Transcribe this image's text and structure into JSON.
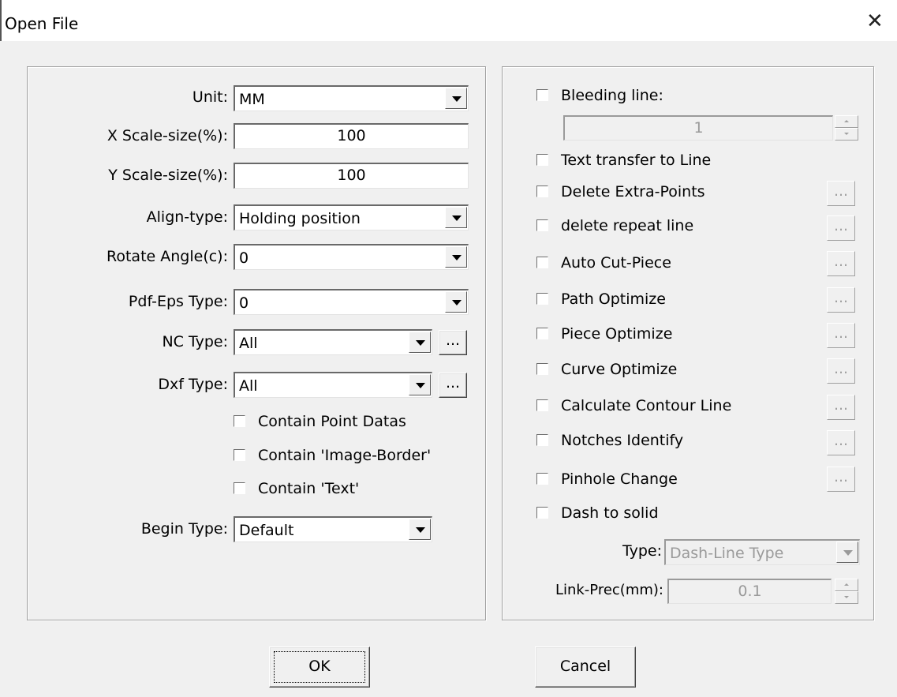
{
  "window": {
    "title": "Open File",
    "close_glyph": "✕"
  },
  "left": {
    "unit": {
      "label": "Unit:",
      "value": "MM"
    },
    "x_scale": {
      "label": "X Scale-size(%):",
      "value": "100"
    },
    "y_scale": {
      "label": "Y Scale-size(%):",
      "value": "100"
    },
    "align": {
      "label": "Align-type:",
      "value": "Holding position"
    },
    "rotate": {
      "label": "Rotate Angle(c):",
      "value": "0"
    },
    "pdf_eps": {
      "label": "Pdf-Eps Type:",
      "value": "0"
    },
    "nc": {
      "label": "NC Type:",
      "value": "All",
      "more": "..."
    },
    "dxf": {
      "label": "Dxf Type:",
      "value": "All",
      "more": "..."
    },
    "checks": {
      "point_datas": "Contain Point Datas",
      "image_border": "Contain 'Image-Border'",
      "text": "Contain 'Text'"
    },
    "begin": {
      "label": "Begin Type:",
      "value": "Default"
    }
  },
  "right": {
    "bleeding": {
      "label": "Bleeding line:",
      "value": "1"
    },
    "options": {
      "text_to_line": "Text transfer to Line",
      "delete_extra": "Delete Extra-Points",
      "delete_repeat": "delete repeat line",
      "auto_cut": "Auto Cut-Piece",
      "path_opt": "Path Optimize",
      "piece_opt": "Piece Optimize",
      "curve_opt": "Curve Optimize",
      "contour": "Calculate Contour Line",
      "notches": "Notches Identify",
      "pinhole": "Pinhole Change",
      "dash_solid": "Dash to solid"
    },
    "more": "...",
    "type": {
      "label": "Type:",
      "value": "Dash-Line Type"
    },
    "link_prec": {
      "label": "Link-Prec(mm):",
      "value": "0.1"
    }
  },
  "buttons": {
    "ok": "OK",
    "cancel": "Cancel"
  }
}
